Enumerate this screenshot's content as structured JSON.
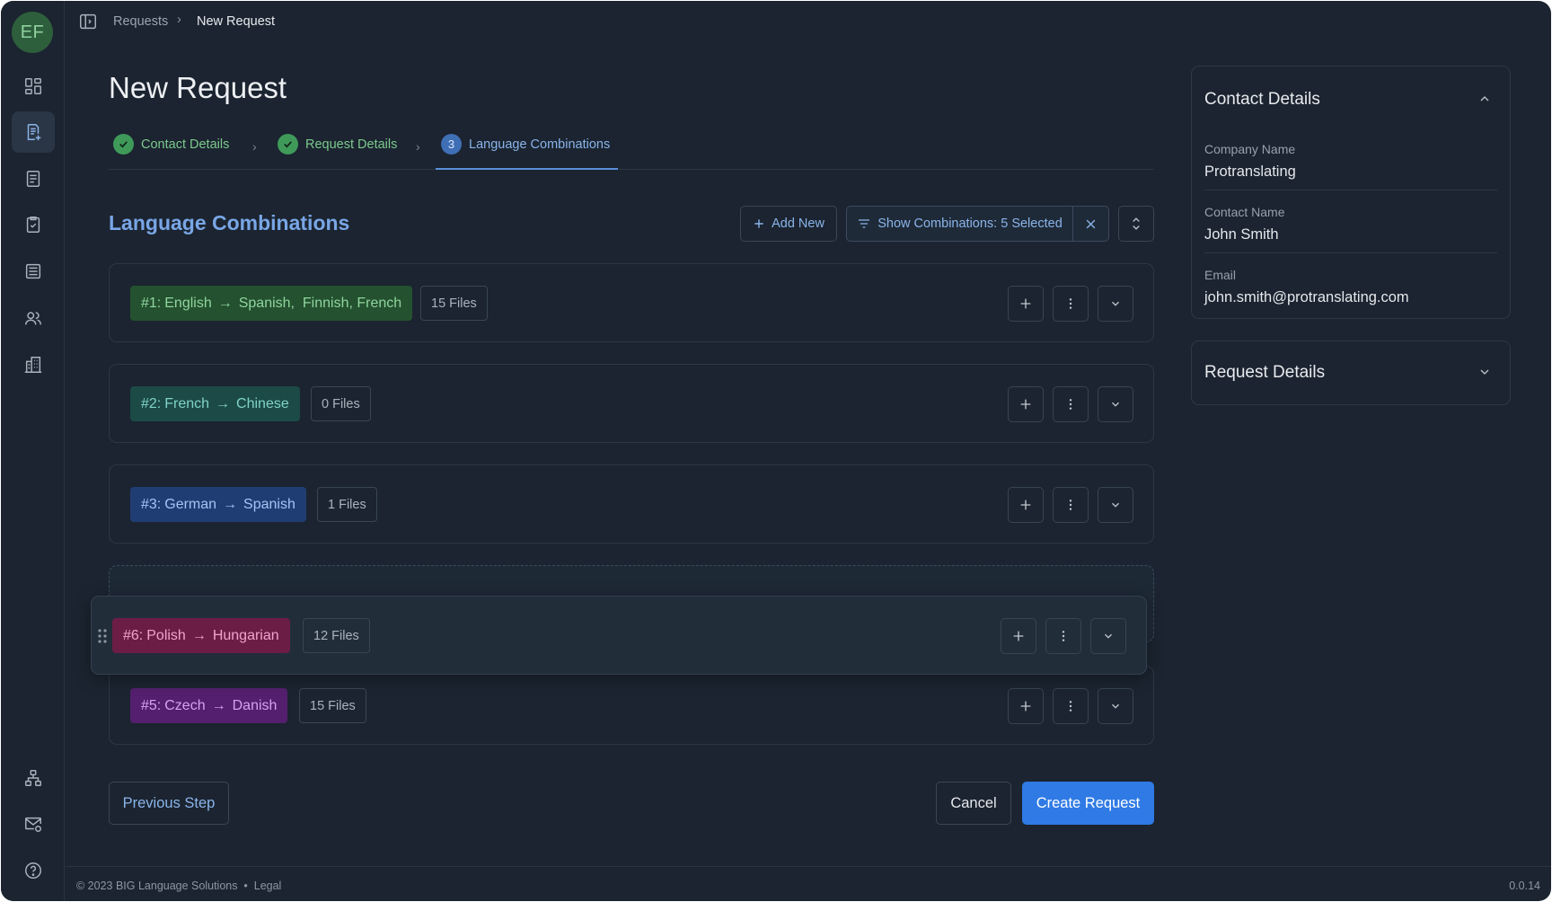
{
  "user": {
    "initials": "EF"
  },
  "breadcrumb": {
    "parent": "Requests",
    "separator": "›",
    "current": "New Request"
  },
  "page_title": "New Request",
  "steps": [
    {
      "label": "Contact Details",
      "status": "complete"
    },
    {
      "label": "Request Details",
      "status": "complete"
    },
    {
      "label": "Language Combinations",
      "status": "current",
      "number": "3"
    }
  ],
  "section": {
    "title": "Language Combinations",
    "add_label": "Add New",
    "filter_label": "Show Combinations: 5 Selected"
  },
  "combinations": [
    {
      "prefix": "#1:",
      "source": "English",
      "targets": "Spanish,  Finnish, French",
      "files": "15 Files",
      "color": "green"
    },
    {
      "prefix": "#2:",
      "source": "French",
      "targets": "Chinese",
      "files": "0 Files",
      "color": "teal"
    },
    {
      "prefix": "#3:",
      "source": "German",
      "targets": "Spanish",
      "files": "1 Files",
      "color": "blue"
    },
    {
      "prefix": "#6:",
      "source": "Polish",
      "targets": "Hungarian",
      "files": "12 Files",
      "color": "pink",
      "dragging": true
    },
    {
      "prefix": "#5:",
      "source": "Czech",
      "targets": "Danish",
      "files": "15 Files",
      "color": "purple"
    }
  ],
  "actions": {
    "previous": "Previous Step",
    "cancel": "Cancel",
    "create": "Create Request"
  },
  "contact_panel": {
    "title": "Contact Details",
    "company_label": "Company Name",
    "company_value": "Protranslating",
    "contact_label": "Contact Name",
    "contact_value": "John Smith",
    "email_label": "Email",
    "email_value": "john.smith@protranslating.com"
  },
  "request_panel": {
    "title": "Request Details"
  },
  "footer": {
    "copyright": "© 2023 BIG Language Solutions  •  Legal",
    "version": "0.0.14"
  },
  "colors": {
    "accent": "#2f7ae5",
    "link": "#8ab4ea",
    "success": "#3f9a5a",
    "background": "#1b2430"
  }
}
